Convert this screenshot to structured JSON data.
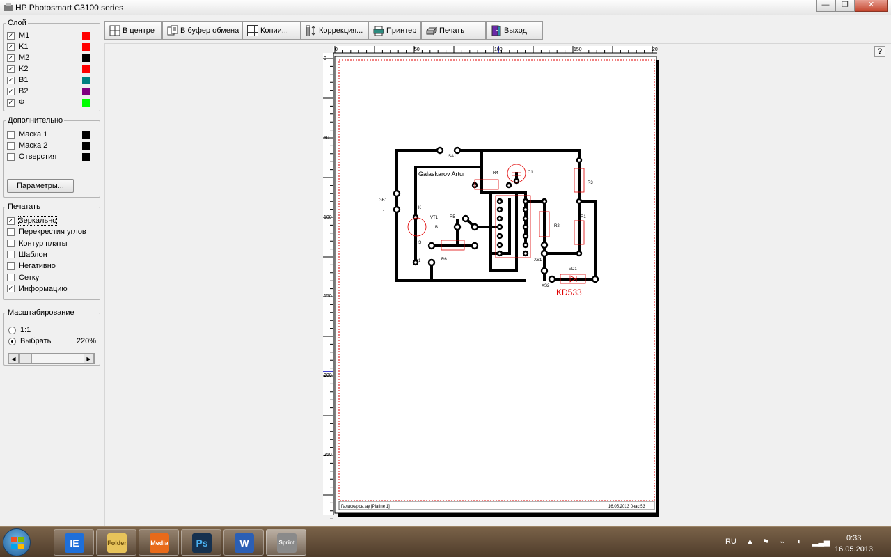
{
  "window": {
    "title": "HP Photosmart C3100 series",
    "minimize_glyph": "—",
    "maximize_glyph": "❐",
    "close_glyph": "✕"
  },
  "toolbar": [
    {
      "label": "В центре",
      "icon": "center-grid-icon"
    },
    {
      "label": "В буфер обмена",
      "icon": "clipboard-copy-icon"
    },
    {
      "label": "Копии...",
      "icon": "copies-grid-icon"
    },
    {
      "label": "Коррекция...",
      "icon": "correction-icon"
    },
    {
      "label": "Принтер",
      "icon": "printer-setup-icon"
    },
    {
      "label": "Печать",
      "icon": "print-icon"
    },
    {
      "label": "Выход",
      "icon": "exit-door-icon"
    }
  ],
  "layers": {
    "legend": "Слой",
    "items": [
      {
        "label": "M1",
        "checked": true,
        "color": "#ff0000"
      },
      {
        "label": "K1",
        "checked": true,
        "color": "#ff0000"
      },
      {
        "label": "M2",
        "checked": true,
        "color": "#000000"
      },
      {
        "label": "K2",
        "checked": true,
        "color": "#ff0000"
      },
      {
        "label": "B1",
        "checked": true,
        "color": "#008080"
      },
      {
        "label": "B2",
        "checked": true,
        "color": "#800080"
      },
      {
        "label": "Ф",
        "checked": true,
        "color": "#00ff00"
      }
    ]
  },
  "extra": {
    "legend": "Дополнительно",
    "items": [
      {
        "label": "Маска 1",
        "checked": false,
        "color": "#000000"
      },
      {
        "label": "Маска 2",
        "checked": false,
        "color": "#000000"
      },
      {
        "label": "Отверстия",
        "checked": false,
        "color": "#000000"
      }
    ],
    "params_button": "Параметры..."
  },
  "print_options": {
    "legend": "Печатать",
    "items": [
      {
        "label": "Зеркально",
        "checked": true
      },
      {
        "label": "Перекрестия углов",
        "checked": false
      },
      {
        "label": "Контур платы",
        "checked": false
      },
      {
        "label": "Шаблон",
        "checked": false
      },
      {
        "label": "Негативно",
        "checked": false
      },
      {
        "label": "Сетку",
        "checked": false
      },
      {
        "label": "Информацию",
        "checked": true
      }
    ]
  },
  "scaling": {
    "legend": "Масштабирование",
    "option_1to1": "1:1",
    "option_select": "Выбрать",
    "selected": "select",
    "value": "220%"
  },
  "canvas": {
    "help_button": "?",
    "ruler_x_ticks": [
      "0",
      "50",
      "100",
      "150",
      "20"
    ],
    "ruler_y_ticks": [
      "0",
      "50",
      "100",
      "150",
      "200",
      "250"
    ],
    "footer_left": "Галаскаров.lay [Platine 1]",
    "footer_right": "16.05.2013 0час:53",
    "pcb_labels": {
      "author": "Galaskarov Artur",
      "sa1": "SA1",
      "gb1": "GB1",
      "c1": "C1",
      "r4": "R4",
      "r3": "R3",
      "vt1": "VT1",
      "r5": "R5",
      "r2": "R2",
      "r1": "R1",
      "r6": "R6",
      "k": "K",
      "b": "B",
      "e": "Э",
      "x1": "X1",
      "xs1": "XS1",
      "xs2": "XS2",
      "vd1": "VD1",
      "kd": "KD533",
      "plus": "+",
      "minus": "-"
    }
  },
  "taskbar": {
    "apps": [
      "IE",
      "Folder",
      "Media",
      "Ps",
      "W",
      "Sprint"
    ],
    "lang": "RU",
    "time": "0:33",
    "date": "16.05.2013"
  }
}
